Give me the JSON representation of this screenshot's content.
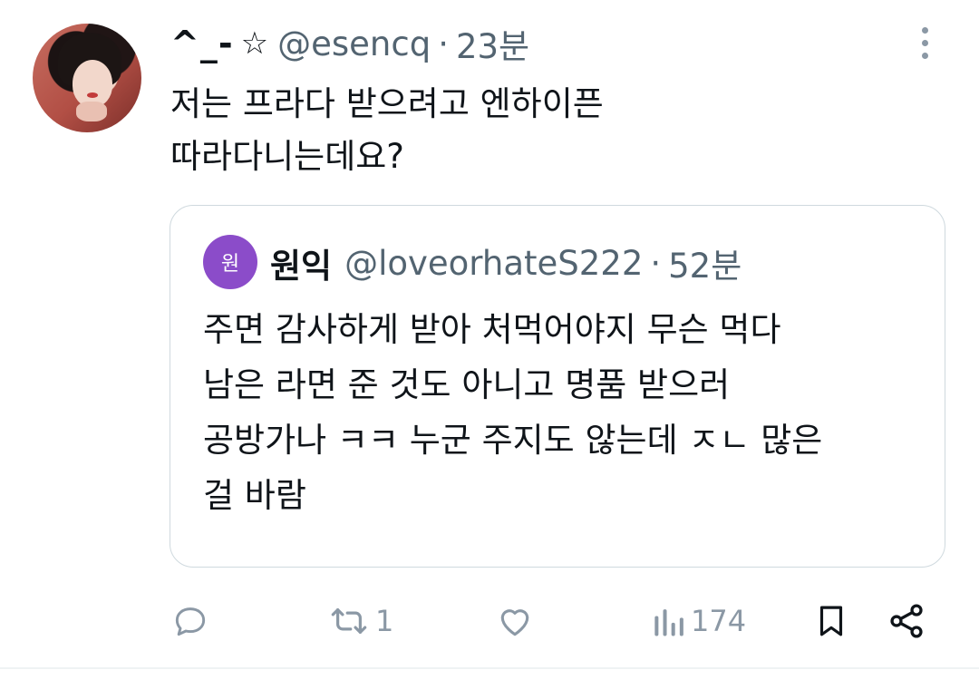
{
  "tweet": {
    "display_name": "^_-",
    "handle": "@esencq",
    "separator": "·",
    "time": "23분",
    "text_lines": [
      "저는 프라다 받으려고 엔하이픈",
      "따라다니는데요?"
    ]
  },
  "quote": {
    "avatar_text": "원",
    "display_name": "원익",
    "handle": "@loveorhateS222",
    "separator": "·",
    "time": "52분",
    "text_lines": [
      "주면 감사하게 받아 처먹어야지 무슨 먹다",
      "남은 라면 준 것도 아니고 명품 받으러",
      "공방가나 ㅋㅋ 누군 주지도 않는데 ㅈㄴ 많은",
      "걸 바람"
    ]
  },
  "actions": {
    "retweet_count": "1",
    "views_count": "174"
  },
  "icons": [
    "star-icon",
    "more-icon",
    "reply-icon",
    "retweet-icon",
    "like-icon",
    "views-icon",
    "bookmark-icon",
    "share-icon"
  ],
  "colors": {
    "secondary_text": "#536471",
    "icon": "#8b98a5",
    "quote_avatar": "#8b4cc9",
    "border": "#cfd9de"
  }
}
